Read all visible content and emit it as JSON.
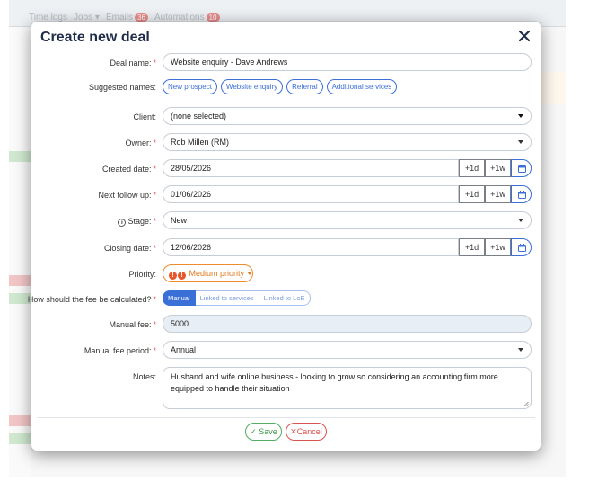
{
  "background": {
    "nav": [
      "Time logs",
      "Jobs",
      "Emails",
      "Automations"
    ],
    "emails_badge": "36",
    "automations_badge": "10"
  },
  "modal": {
    "title": "Create new deal",
    "fields": {
      "deal_name": {
        "label": "Deal name:",
        "value": "Website enquiry - Dave Andrews"
      },
      "suggested_names": {
        "label": "Suggested names:",
        "chips": [
          "New prospect",
          "Website enquiry",
          "Referral",
          "Additional services"
        ]
      },
      "client": {
        "label": "Client:",
        "value": "(none selected)"
      },
      "owner": {
        "label": "Owner:",
        "value": "Rob Millen (RM)"
      },
      "created_date": {
        "label": "Created date:",
        "value": "28/05/2026"
      },
      "next_follow_up": {
        "label": "Next follow up:",
        "value": "01/06/2026"
      },
      "stage": {
        "label": "Stage:",
        "value": "New"
      },
      "closing_date": {
        "label": "Closing date:",
        "value": "12/06/2026"
      },
      "priority": {
        "label": "Priority:",
        "value": "Medium priority",
        "icon_text": "!"
      },
      "fee_calc": {
        "label": "How should the fee be calculated?",
        "options": [
          "Manual",
          "Linked to services",
          "Linked to LoE"
        ],
        "selected": "Manual"
      },
      "manual_fee": {
        "label": "Manual fee:",
        "value": "5000"
      },
      "manual_fee_period": {
        "label": "Manual fee period:",
        "value": "Annual"
      },
      "notes": {
        "label": "Notes:",
        "value": "Husband and wife online business - looking to grow so considering an accounting firm more equipped to handle their situation"
      }
    },
    "date_buttons": {
      "plus_day": "+1d",
      "plus_week": "+1w"
    },
    "required_mark": "*",
    "info_mark": "i",
    "save_label": "Save",
    "cancel_label": "Cancel"
  },
  "colors": {
    "accent": "#3c6fd6",
    "required": "#d9534f",
    "priority": "#ef8a2d",
    "save": "#52ad5f",
    "cancel": "#d9534f",
    "title": "#1f2d4a"
  },
  "icons": [
    "close-icon",
    "calendar-icon",
    "info-icon",
    "check-icon",
    "x-icon",
    "chevron-down-icon"
  ]
}
